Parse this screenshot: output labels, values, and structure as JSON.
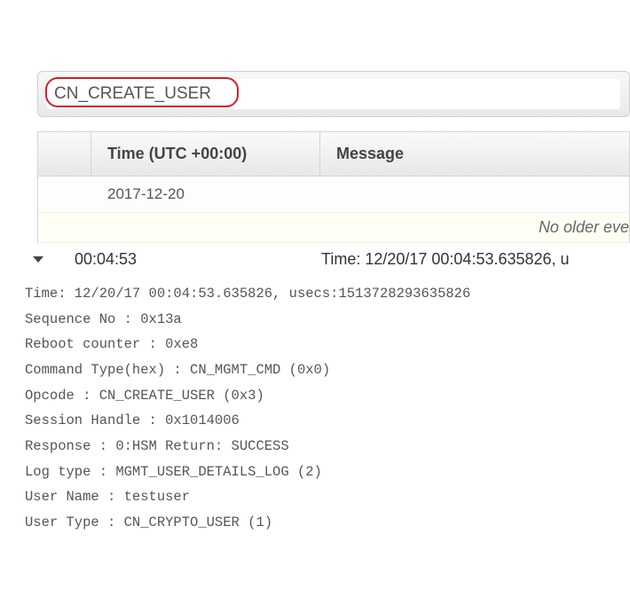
{
  "search": {
    "value": "CN_CREATE_USER"
  },
  "columns": {
    "time": "Time (UTC +00:00)",
    "message": "Message"
  },
  "date_group": "2017-12-20",
  "no_older_text": "No older eve",
  "event": {
    "time": "00:04:53",
    "message": "Time: 12/20/17 00:04:53.635826, u"
  },
  "details": {
    "l0": "Time: 12/20/17 00:04:53.635826, usecs:1513728293635826",
    "l1": "Sequence No : 0x13a",
    "l2": "Reboot counter : 0xe8",
    "l3": "Command Type(hex) : CN_MGMT_CMD (0x0)",
    "l4": "Opcode : CN_CREATE_USER (0x3)",
    "l5": "Session Handle : 0x1014006",
    "l6": "Response : 0:HSM Return: SUCCESS",
    "l7": "Log type : MGMT_USER_DETAILS_LOG (2)",
    "l8": "User Name : testuser",
    "l9": "User Type : CN_CRYPTO_USER (1)"
  }
}
